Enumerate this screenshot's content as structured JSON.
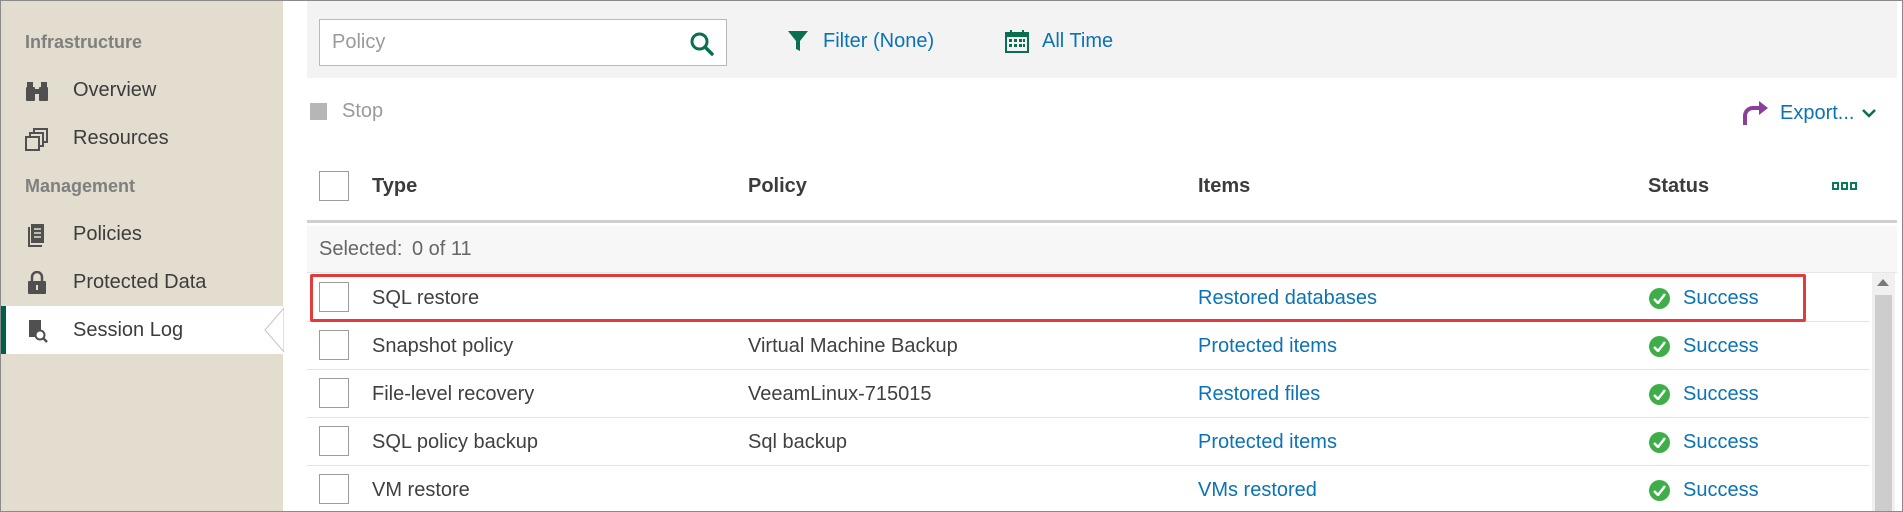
{
  "sidebar": {
    "sections": [
      {
        "label": "Infrastructure"
      },
      {
        "label": "Management"
      }
    ],
    "items": [
      {
        "label": "Overview",
        "icon": "binoculars-icon"
      },
      {
        "label": "Resources",
        "icon": "resources-icon"
      },
      {
        "label": "Policies",
        "icon": "policies-icon"
      },
      {
        "label": "Protected Data",
        "icon": "lock-icon"
      },
      {
        "label": "Session Log",
        "icon": "session-log-icon",
        "active": true
      }
    ]
  },
  "toolbar": {
    "search_placeholder": "Policy",
    "search_value": "",
    "filter_label": "Filter (None)",
    "time_label": "All Time",
    "stop_label": "Stop",
    "export_label": "Export..."
  },
  "table": {
    "columns": [
      "Type",
      "Policy",
      "Items",
      "Status"
    ],
    "selected_label": "Selected:",
    "selected_value": "0 of 11",
    "rows": [
      {
        "type": "SQL restore",
        "policy": "",
        "items": "Restored databases",
        "status": "Success"
      },
      {
        "type": "Snapshot policy",
        "policy": "Virtual Machine Backup",
        "items": "Protected items",
        "status": "Success"
      },
      {
        "type": "File-level recovery",
        "policy": "VeeamLinux-715015",
        "items": "Restored files",
        "status": "Success"
      },
      {
        "type": "SQL policy backup",
        "policy": "Sql backup",
        "items": "Protected items",
        "status": "Success"
      },
      {
        "type": "VM restore",
        "policy": "",
        "items": "VMs restored",
        "status": "Success"
      }
    ]
  },
  "colors": {
    "accent": "#0b73b5",
    "brand": "#005f4b",
    "success": "#3fae49",
    "highlight": "#e23b3b",
    "sidebar_bg": "#e3ddd0"
  }
}
